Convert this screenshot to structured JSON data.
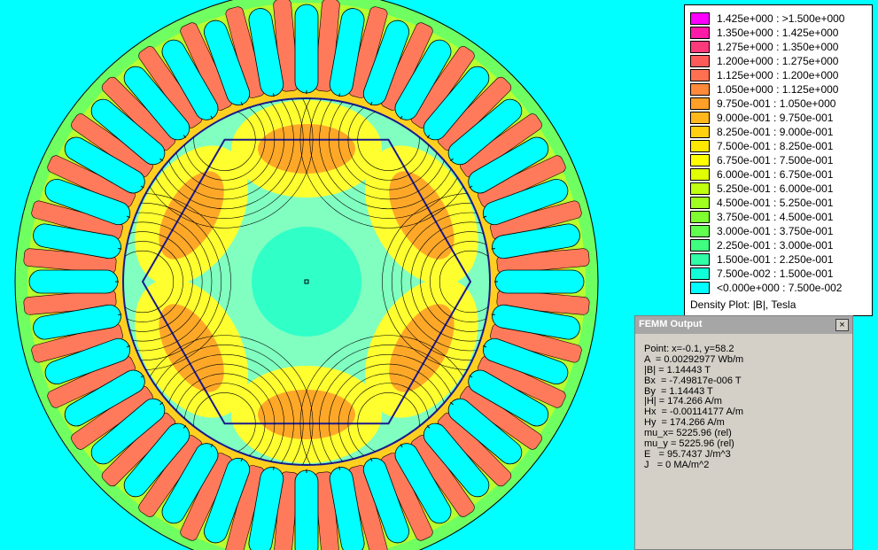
{
  "legend": {
    "items": [
      {
        "label": "1.425e+000 : >1.500e+000",
        "color": "#ff00ff"
      },
      {
        "label": "1.350e+000 : 1.425e+000",
        "color": "#ff1aa8"
      },
      {
        "label": "1.275e+000 : 1.350e+000",
        "color": "#ff3a7a"
      },
      {
        "label": "1.200e+000 : 1.275e+000",
        "color": "#ff5a5a"
      },
      {
        "label": "1.125e+000 : 1.200e+000",
        "color": "#ff7050"
      },
      {
        "label": "1.050e+000 : 1.125e+000",
        "color": "#ff8a3c"
      },
      {
        "label": "9.750e-001 : 1.050e+000",
        "color": "#ffa028"
      },
      {
        "label": "9.000e-001 : 9.750e-001",
        "color": "#ffb81c"
      },
      {
        "label": "8.250e-001 : 9.000e-001",
        "color": "#ffd010"
      },
      {
        "label": "7.500e-001 : 8.250e-001",
        "color": "#ffe800"
      },
      {
        "label": "6.750e-001 : 7.500e-001",
        "color": "#ffff00"
      },
      {
        "label": "6.000e-001 : 6.750e-001",
        "color": "#e0ff00"
      },
      {
        "label": "5.250e-001 : 6.000e-001",
        "color": "#c0ff10"
      },
      {
        "label": "4.500e-001 : 5.250e-001",
        "color": "#a0ff20"
      },
      {
        "label": "3.750e-001 : 4.500e-001",
        "color": "#80ff30"
      },
      {
        "label": "3.000e-001 : 3.750e-001",
        "color": "#60ff50"
      },
      {
        "label": "2.250e-001 : 3.000e-001",
        "color": "#40ff80"
      },
      {
        "label": "1.500e-001 : 2.250e-001",
        "color": "#30ffa8"
      },
      {
        "label": "7.500e-002 : 1.500e-001",
        "color": "#10ffd8"
      },
      {
        "label": "<0.000e+000 : 7.500e-002",
        "color": "#00ffff"
      }
    ],
    "caption": "Density Plot: |B|, Tesla"
  },
  "output": {
    "title": "FEMM Output",
    "close_label": "×",
    "lines": [
      "Point: x=-0.1, y=58.2",
      "A  = 0.00292977 Wb/m",
      "|B| = 1.14443 T",
      "Bx  = -7.49817e-006 T",
      "By  = 1.14443 T",
      "|H| = 174.266 A/m",
      "Hx  = -0.00114177 A/m",
      "Hy  = 174.266 A/m",
      "mu_x= 5225.96 (rel)",
      "mu_y = 5225.96 (rel)",
      "E   = 95.7437 J/m^3",
      "J   = 0 MA/m^2"
    ]
  },
  "plot": {
    "stator_slots": 36,
    "rotor_poles": 6,
    "colors": {
      "background": "#00ffff",
      "yoke": "#b8ff30",
      "yoke_outer": "#70ff60",
      "tooth": "#ff7a5a",
      "tooth_root": "#ffd020",
      "rotor_low": "#80ffc0",
      "rotor_mid": "#ffff30",
      "rotor_hi": "#ffa828",
      "center": "#30ffc8",
      "line": "#000000",
      "airgap_line": "#1a1a8c"
    }
  }
}
